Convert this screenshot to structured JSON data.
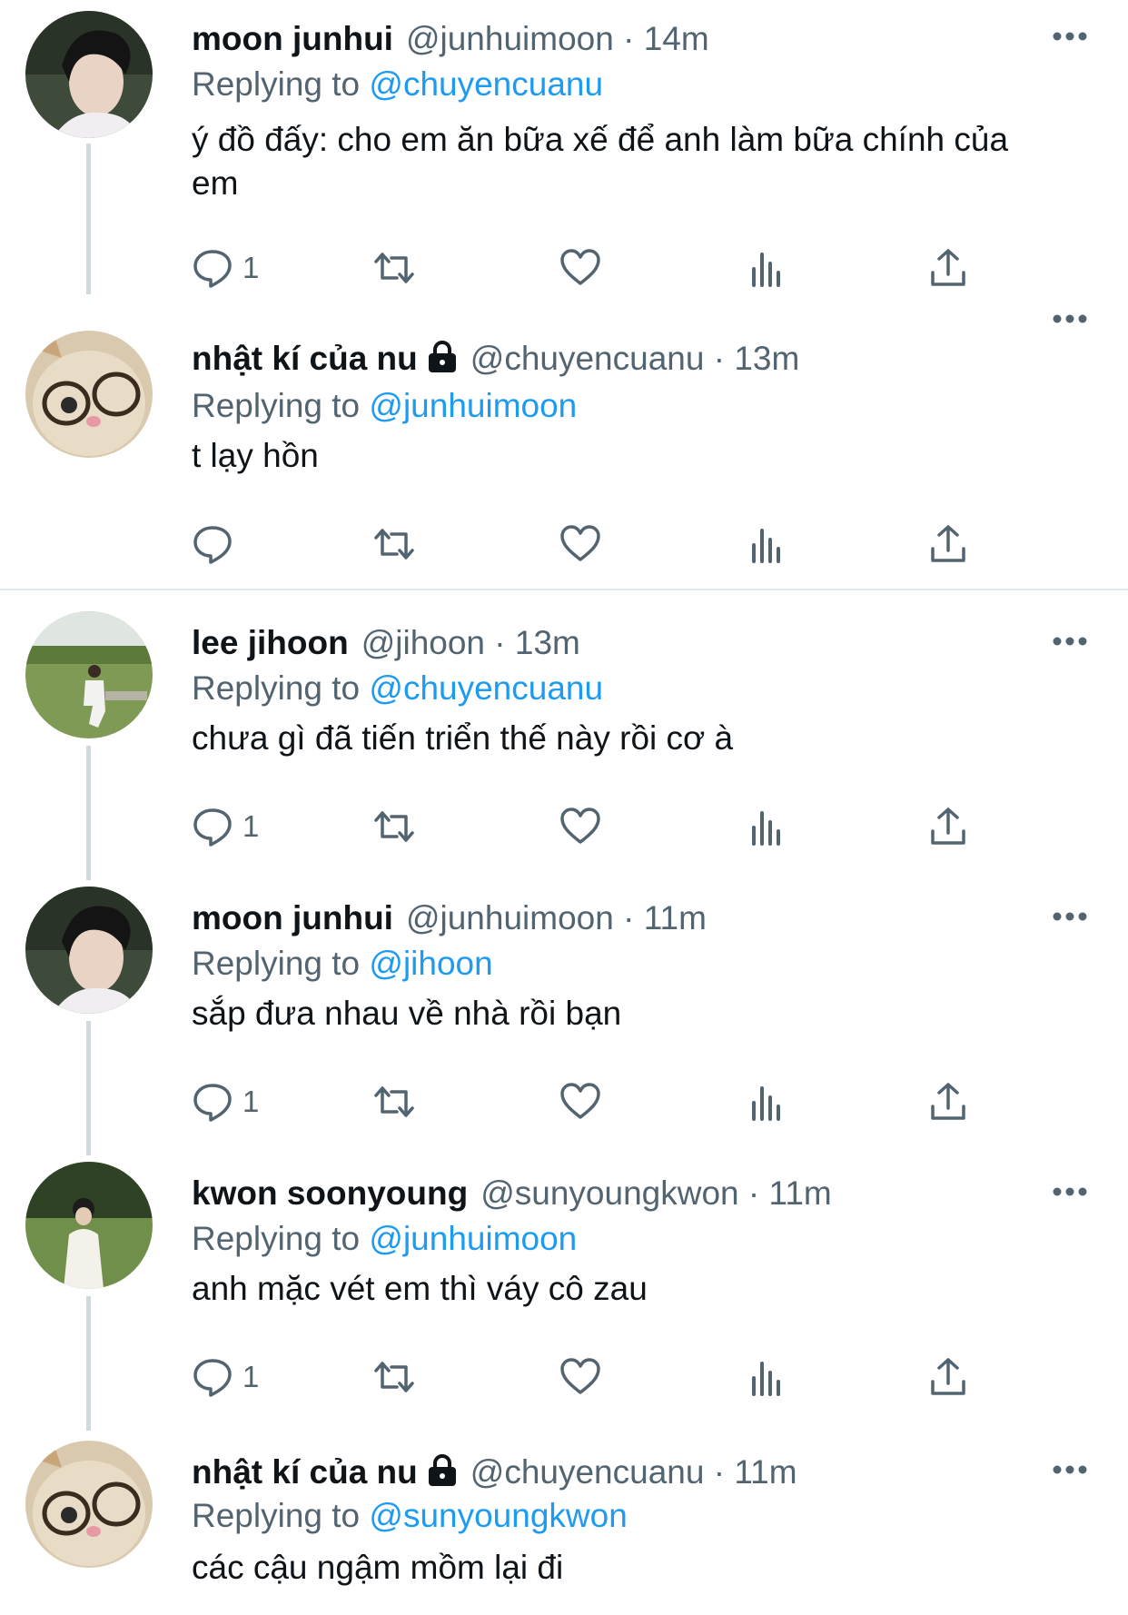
{
  "tweets": [
    {
      "name": "moon junhui",
      "locked": false,
      "handle_time": "@junhuimoon · 14m",
      "replying_label": "Replying to",
      "replying_to": "@chuyencuanu",
      "text": "ý đồ đấy: cho em ăn bữa xế để anh làm bữa chính của em",
      "reply_count": "1",
      "avatar": "dark-hair-profile"
    },
    {
      "name": "nhật kí của nu",
      "locked": true,
      "handle_time": "@chuyencuanu · 13m",
      "replying_label": "Replying to",
      "replying_to": "@junhuimoon",
      "text": "t lạy hồn",
      "reply_count": "",
      "avatar": "cat-with-glasses"
    },
    {
      "name": "lee jihoon",
      "locked": false,
      "handle_time": "@jihoon · 13m",
      "replying_label": "Replying to",
      "replying_to": "@chuyencuanu",
      "text": "chưa gì đã tiến triển thế này rồi cơ à",
      "reply_count": "1",
      "avatar": "person-on-grass"
    },
    {
      "name": "moon junhui",
      "locked": false,
      "handle_time": "@junhuimoon · 11m",
      "replying_label": "Replying to",
      "replying_to": "@jihoon",
      "text": "sắp đưa nhau về nhà rồi bạn",
      "reply_count": "1",
      "avatar": "dark-hair-profile"
    },
    {
      "name": "kwon soonyoung",
      "locked": false,
      "handle_time": "@sunyoungkwon · 11m",
      "replying_label": "Replying to",
      "replying_to": "@junhuimoon",
      "text": "anh mặc vét em thì váy cô zau",
      "reply_count": "1",
      "avatar": "person-in-field"
    },
    {
      "name": "nhật kí của nu",
      "locked": true,
      "handle_time": "@chuyencuanu · 11m",
      "replying_label": "Replying to",
      "replying_to": "@sunyoungkwon",
      "text": "các cậu ngậm mồm lại đi",
      "reply_count": "",
      "avatar": "cat-with-glasses"
    }
  ],
  "icons": {
    "reply": "reply-bubble-icon",
    "retweet": "retweet-icon",
    "like": "heart-icon",
    "stats": "view-stats-icon",
    "share": "share-icon",
    "more": "more-dots-icon",
    "lock": "lock-icon"
  },
  "colors": {
    "text": "#0f1419",
    "secondary": "#536471",
    "link": "#1d9bf0",
    "thread_line": "#cfd9de",
    "divider": "#e1e8ed"
  }
}
